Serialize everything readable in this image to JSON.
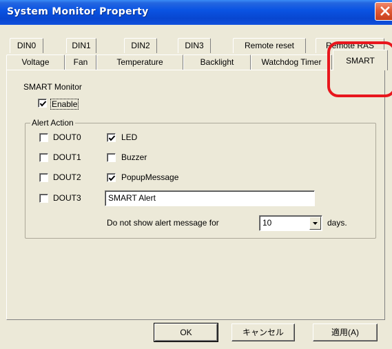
{
  "window": {
    "title": "System Monitor Property"
  },
  "tabs": {
    "row1": [
      "DIN0",
      "DIN1",
      "DIN2",
      "DIN3",
      "Remote reset",
      "Remote RAS"
    ],
    "row2": [
      "Voltage",
      "Fan",
      "Temperature",
      "Backlight",
      "Watchdog Timer",
      "SMART"
    ],
    "active": "SMART"
  },
  "smart": {
    "section_label": "SMART Monitor",
    "enable_label": "Enable",
    "enable_checked": true,
    "alert_action_label": "Alert Action",
    "douts": [
      {
        "label": "DOUT0",
        "checked": false
      },
      {
        "label": "DOUT1",
        "checked": false
      },
      {
        "label": "DOUT2",
        "checked": false
      },
      {
        "label": "DOUT3",
        "checked": false
      }
    ],
    "actions": [
      {
        "label": "LED",
        "checked": true
      },
      {
        "label": "Buzzer",
        "checked": false
      },
      {
        "label": "PopupMessage",
        "checked": true
      }
    ],
    "message_value": "SMART Alert",
    "suppress_prefix": "Do not show alert message for",
    "suppress_value": "10",
    "suppress_suffix": "days."
  },
  "buttons": {
    "ok": "OK",
    "cancel": "キャンセル",
    "apply": "適用(A)"
  },
  "colors": {
    "titlebar": "#0a54e3",
    "highlight": "#e8161d",
    "face": "#ece9d8"
  }
}
